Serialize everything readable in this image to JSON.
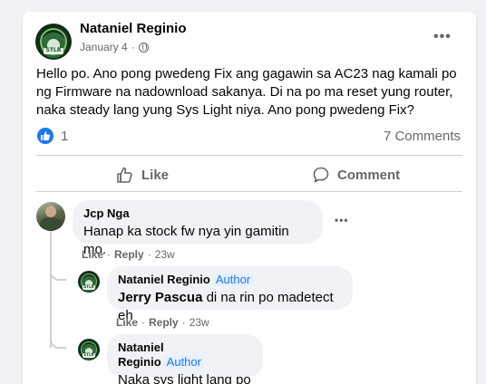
{
  "post": {
    "author": "Nataniel Reginio",
    "date": "January 4",
    "separator": "·",
    "privacy_icon": "globe-icon",
    "more_label": "•••",
    "text": "Hello po. Ano pong pwedeng Fix ang gagawin sa AC23 nag kamali po ng Firmware na nadownload sakanya. Di na po ma reset yung router, naka steady lang yung Sys Light niya. Ano pong pwedeng Fix?",
    "reaction_count": "1",
    "comment_count": "7 Comments",
    "actions": {
      "like": "Like",
      "comment": "Comment"
    }
  },
  "avatar_tag": "STLR",
  "comments": [
    {
      "author": "Jcp Nga",
      "text": "Hanap ka stock fw nya yin gamitin mo.",
      "like": "Like",
      "reply": "Reply",
      "dot": "·",
      "time": "23w",
      "more_label": "•••"
    }
  ],
  "replies": [
    {
      "author": "Nataniel Reginio",
      "badge": "Author",
      "mention": "Jerry Pascua",
      "text": " di na rin po madetect eh",
      "like": "Like",
      "reply": "Reply",
      "dot": "·",
      "time": "23w"
    },
    {
      "author": "Nataniel Reginio",
      "badge": "Author",
      "text": "Naka sys light lang po"
    }
  ],
  "colors": {
    "accent": "#1877f2",
    "muted": "#65676b",
    "bubble": "#f0f2f5",
    "background": "#f0f2f5"
  }
}
